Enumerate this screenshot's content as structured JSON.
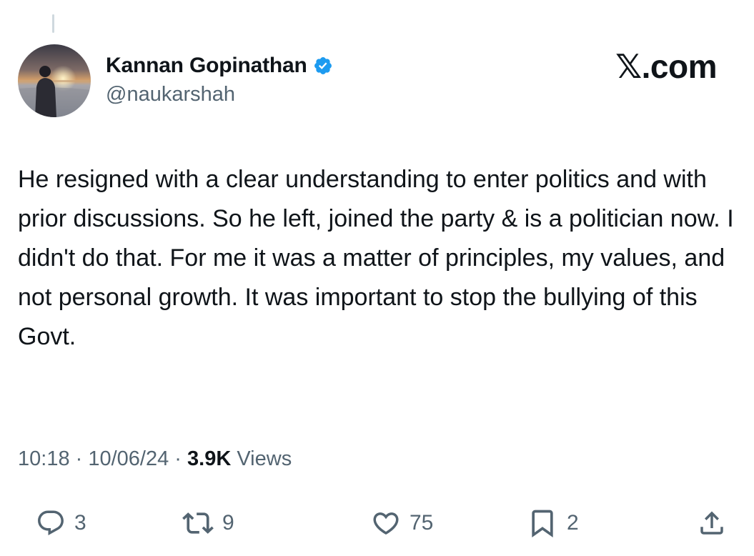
{
  "author": {
    "display_name": "Kannan Gopinathan",
    "handle": "@naukarshah",
    "verified": true
  },
  "site_logo": "𝕏.com",
  "tweet": {
    "text": "He resigned with a clear understanding to enter politics and with prior discussions. So he left, joined the party & is a politician now. I didn't do that. For me it was a matter of principles, my values, and not personal growth. It was important to stop the bullying of this Govt."
  },
  "meta": {
    "time": "10:18",
    "date": "10/06/24",
    "views_count": "3.9K",
    "views_label": "Views",
    "separator": " · "
  },
  "actions": {
    "replies": "3",
    "reposts": "9",
    "likes": "75",
    "bookmarks": "2"
  },
  "colors": {
    "text": "#0f1419",
    "secondary": "#536471",
    "verified": "#1d9bf0"
  }
}
